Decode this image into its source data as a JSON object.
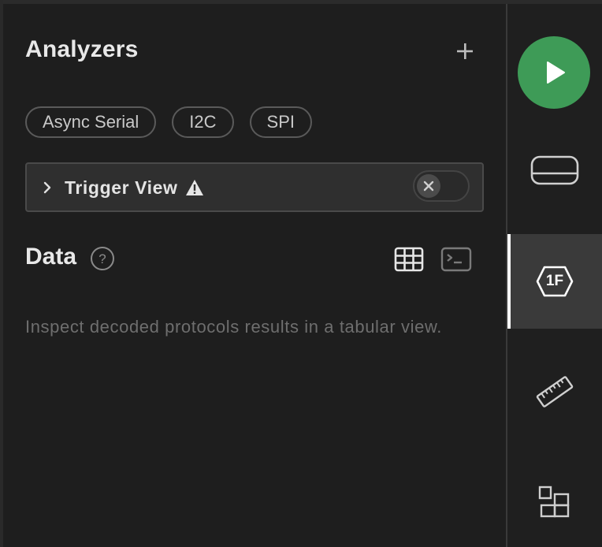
{
  "analyzers": {
    "title": "Analyzers",
    "add_icon": "plus-icon",
    "chips": [
      {
        "label": "Async Serial"
      },
      {
        "label": "I2C"
      },
      {
        "label": "SPI"
      }
    ]
  },
  "trigger_view": {
    "label": "Trigger View",
    "expand_icon": "chevron-right-icon",
    "warning_icon": "warning-icon",
    "toggle_state": "off"
  },
  "data_section": {
    "title": "Data",
    "help_icon": "question-circle-icon",
    "table_view_icon": "grid-table-icon",
    "terminal_view_icon": "terminal-icon",
    "empty_message": "Inspect decoded protocols results in a tabular view."
  },
  "rail": {
    "items": [
      {
        "icon": "play-icon"
      },
      {
        "icon": "device-icon"
      },
      {
        "icon": "analyzers-hex-icon",
        "badge": "1F",
        "active": true
      },
      {
        "icon": "ruler-icon"
      },
      {
        "icon": "extensions-icon"
      }
    ]
  },
  "colors": {
    "background": "#1e1e1e",
    "play_green": "#3e9b57",
    "active_rail": "#3a3a3a",
    "muted_text": "#6e6e6e"
  }
}
